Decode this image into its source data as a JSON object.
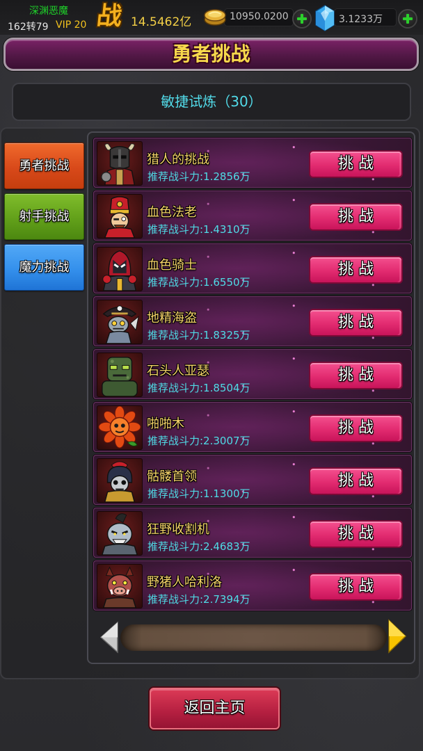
{
  "top_bar": {
    "player_name": "深渊恶魔",
    "rebirth_level": "162转79",
    "vip_level": "VIP 20",
    "battle_glyph": "战",
    "battle_power": "14.5462亿",
    "gold_amount": "10950.0200",
    "diamond_amount": "3.1233万",
    "icons": [
      "gold-coin-icon",
      "add-gold-plus-icon",
      "diamond-icon",
      "add-diamond-plus-icon"
    ]
  },
  "header": {
    "title": "勇者挑战"
  },
  "trial": {
    "label": "敏捷试炼（30）"
  },
  "tabs": [
    {
      "label": "勇者挑战",
      "color": "#d8491a",
      "selected": true
    },
    {
      "label": "射手挑战",
      "color": "#62a01a",
      "selected": false
    },
    {
      "label": "魔力挑战",
      "color": "#3490ec",
      "selected": false
    }
  ],
  "challenges": [
    {
      "name": "猎人的挑战",
      "recommended_power": "推荐战斗力:1.2856万",
      "action": "挑 战",
      "avatar": "horned-hunter-avatar"
    },
    {
      "name": "血色法老",
      "recommended_power": "推荐战斗力:1.4310万",
      "action": "挑 战",
      "avatar": "pharaoh-avatar"
    },
    {
      "name": "血色骑士",
      "recommended_power": "推荐战斗力:1.6550万",
      "action": "挑 战",
      "avatar": "knight-avatar"
    },
    {
      "name": "地精海盗",
      "recommended_power": "推荐战斗力:1.8325万",
      "action": "挑 战",
      "avatar": "goblin-pirate-avatar"
    },
    {
      "name": "石头人亚瑟",
      "recommended_power": "推荐战斗力:1.8504万",
      "action": "挑 战",
      "avatar": "stone-golem-avatar"
    },
    {
      "name": "啪啪木",
      "recommended_power": "推荐战斗力:2.3007万",
      "action": "挑 战",
      "avatar": "flower-creature-avatar"
    },
    {
      "name": "骷髅首领",
      "recommended_power": "推荐战斗力:1.1300万",
      "action": "挑 战",
      "avatar": "skeleton-chief-avatar"
    },
    {
      "name": "狂野收割机",
      "recommended_power": "推荐战斗力:2.4683万",
      "action": "挑 战",
      "avatar": "reaper-avatar"
    },
    {
      "name": "野猪人哈利洛",
      "recommended_power": "推荐战斗力:2.7394万",
      "action": "挑 战",
      "avatar": "boarman-avatar"
    }
  ],
  "pager": {
    "prev_icon": "left-arrow-icon",
    "next_icon": "right-arrow-icon"
  },
  "footer": {
    "back_label": "返回主页"
  },
  "colors": {
    "name_text": "#f5d36a",
    "power_text": "#4fdbe6",
    "challenge_button": "#e22b70",
    "title_text": "#f7d94c",
    "trial_text": "#52dbe9",
    "player_name_text": "#1fd12a"
  }
}
